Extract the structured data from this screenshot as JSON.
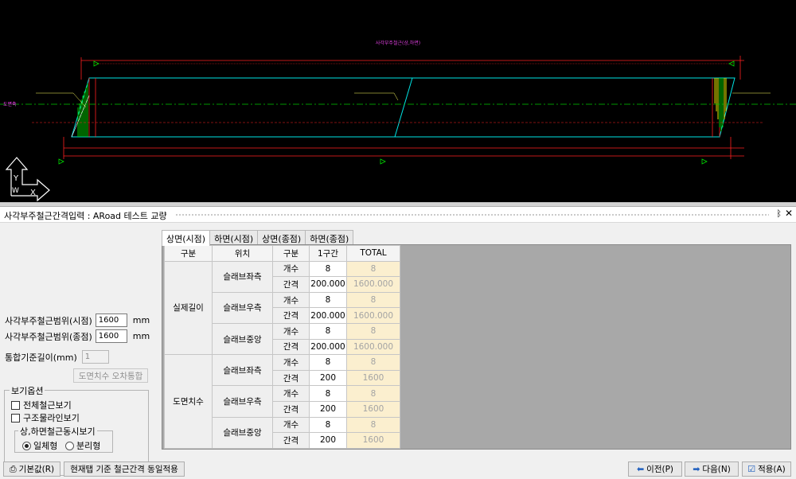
{
  "drawing": {
    "title": "사각부주철근(상,하면)",
    "axis_y": "Y",
    "axis_w": "W",
    "axis_x": "X",
    "left_label": "도면축"
  },
  "panel": {
    "title": "사각부주철근간격입력 : ARoad 테스트 교량",
    "pin_glyph": "ᛒ",
    "close_glyph": "✕"
  },
  "form": {
    "start_range_label": "사각부주철근범위(시점)",
    "start_range_value": "1600",
    "end_range_label": "사각부주철근범위(종점)",
    "end_range_value": "1600",
    "unit": "mm",
    "merge_length_label": "통합기준길이(mm)",
    "merge_length_value": "1",
    "merge_button": "도면치수 오차통합"
  },
  "view_options": {
    "legend": "보기옵션",
    "show_all_rebar": "전체철근보기",
    "show_structure_line": "구조물라인보기",
    "sub_legend": "상,하면철근동시보기",
    "radio_integrated": "일체형",
    "radio_separate": "분리형"
  },
  "tabs": [
    "상면(시점)",
    "하면(시점)",
    "상면(종점)",
    "하면(종점)"
  ],
  "table": {
    "headers": [
      "구분",
      "위치",
      "구분",
      "1구간",
      "TOTAL"
    ],
    "groups": [
      {
        "name": "실제길이",
        "positions": [
          {
            "name": "슬래브좌측",
            "rows": [
              {
                "kind": "개수",
                "v1": "8",
                "total": "8"
              },
              {
                "kind": "간격",
                "v1": "200.000",
                "total": "1600.000"
              }
            ]
          },
          {
            "name": "슬래브우측",
            "rows": [
              {
                "kind": "개수",
                "v1": "8",
                "total": "8"
              },
              {
                "kind": "간격",
                "v1": "200.000",
                "total": "1600.000"
              }
            ]
          },
          {
            "name": "슬래브중앙",
            "rows": [
              {
                "kind": "개수",
                "v1": "8",
                "total": "8"
              },
              {
                "kind": "간격",
                "v1": "200.000",
                "total": "1600.000"
              }
            ]
          }
        ]
      },
      {
        "name": "도면치수",
        "positions": [
          {
            "name": "슬래브좌측",
            "rows": [
              {
                "kind": "개수",
                "v1": "8",
                "total": "8"
              },
              {
                "kind": "간격",
                "v1": "200",
                "total": "1600"
              }
            ]
          },
          {
            "name": "슬래브우측",
            "rows": [
              {
                "kind": "개수",
                "v1": "8",
                "total": "8"
              },
              {
                "kind": "간격",
                "v1": "200",
                "total": "1600"
              }
            ]
          },
          {
            "name": "슬래브중앙",
            "rows": [
              {
                "kind": "개수",
                "v1": "8",
                "total": "8"
              },
              {
                "kind": "간격",
                "v1": "200",
                "total": "1600"
              }
            ]
          }
        ]
      }
    ]
  },
  "bottom": {
    "default_button": "기본값(R)",
    "apply_same_button": "현재탭 기준 철근간격 동일적용",
    "prev_button": "이전(P)",
    "next_button": "다음(N)",
    "apply_button": "적용(A)"
  },
  "colors": {
    "cad_background": "#000000",
    "slab_outline": "#00e5e5",
    "dimension": "#ff2020",
    "rebar_hatch": "#00c800",
    "rebar_yellow": "#e8e800",
    "title_magenta": "#e040e0",
    "total_cell_bg": "#fbefcf"
  }
}
